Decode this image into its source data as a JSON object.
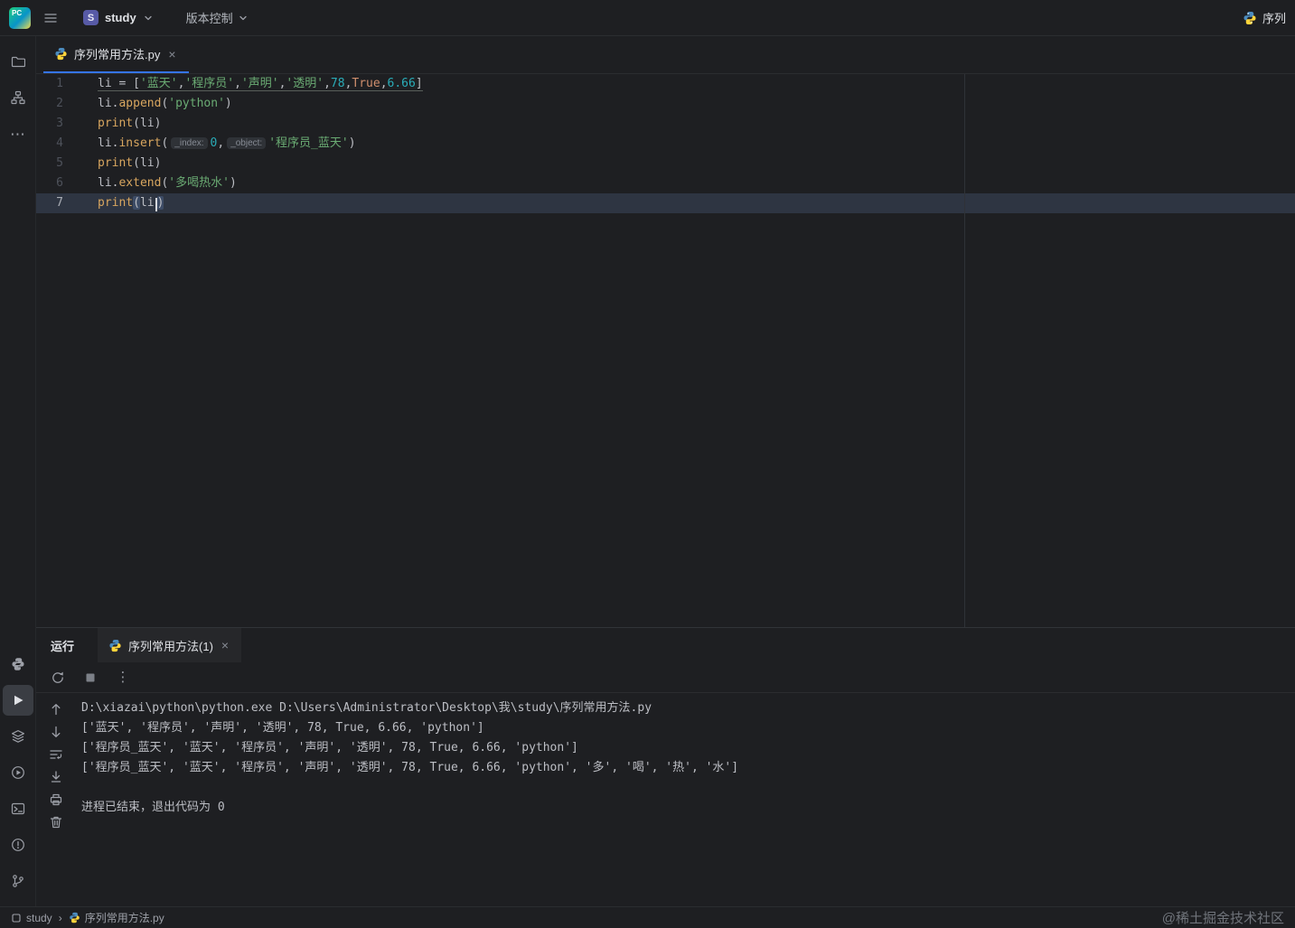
{
  "titlebar": {
    "logo": "PC",
    "project_badge": "S",
    "project": "study",
    "vcs": "版本控制",
    "run_config": "序列"
  },
  "editor": {
    "tab_label": "序列常用方法.py",
    "close": "×",
    "lines": [
      {
        "n": 1,
        "active": false,
        "tokens": [
          {
            "t": "li",
            "c": "v u"
          },
          {
            "t": " = ",
            "c": "v u"
          },
          {
            "t": "[",
            "c": "v u"
          },
          {
            "t": "'蓝天'",
            "c": "s u"
          },
          {
            "t": ",",
            "c": "v u"
          },
          {
            "t": "'程序员'",
            "c": "s u"
          },
          {
            "t": ",",
            "c": "v u"
          },
          {
            "t": "'声明'",
            "c": "s u"
          },
          {
            "t": ",",
            "c": "v u"
          },
          {
            "t": "'透明'",
            "c": "s u"
          },
          {
            "t": ",",
            "c": "v u"
          },
          {
            "t": "78",
            "c": "n u"
          },
          {
            "t": ",",
            "c": "v u"
          },
          {
            "t": "True",
            "c": "k u"
          },
          {
            "t": ",",
            "c": "v u"
          },
          {
            "t": "6.66",
            "c": "n u"
          },
          {
            "t": "]",
            "c": "v u"
          }
        ]
      },
      {
        "n": 2,
        "active": false,
        "tokens": [
          {
            "t": "li.",
            "c": "v"
          },
          {
            "t": "append",
            "c": "m"
          },
          {
            "t": "(",
            "c": "v"
          },
          {
            "t": "'python'",
            "c": "s"
          },
          {
            "t": ")",
            "c": "v"
          }
        ]
      },
      {
        "n": 3,
        "active": false,
        "tokens": [
          {
            "t": "print",
            "c": "m"
          },
          {
            "t": "(",
            "c": "v"
          },
          {
            "t": "li",
            "c": "v"
          },
          {
            "t": ")",
            "c": "v"
          }
        ]
      },
      {
        "n": 4,
        "active": false,
        "tokens": [
          {
            "t": "li.",
            "c": "v"
          },
          {
            "t": "insert",
            "c": "m"
          },
          {
            "t": "(",
            "c": "v"
          },
          {
            "t": "_index:",
            "c": "h"
          },
          {
            "t": "0",
            "c": "n"
          },
          {
            "t": ",",
            "c": "v"
          },
          {
            "t": "_object:",
            "c": "h"
          },
          {
            "t": "'程序员_蓝天'",
            "c": "s"
          },
          {
            "t": ")",
            "c": "v"
          }
        ]
      },
      {
        "n": 5,
        "active": false,
        "tokens": [
          {
            "t": "print",
            "c": "m"
          },
          {
            "t": "(",
            "c": "v"
          },
          {
            "t": "li",
            "c": "v"
          },
          {
            "t": ")",
            "c": "v"
          }
        ]
      },
      {
        "n": 6,
        "active": false,
        "tokens": [
          {
            "t": "li.",
            "c": "v"
          },
          {
            "t": "extend",
            "c": "m"
          },
          {
            "t": "(",
            "c": "v"
          },
          {
            "t": "'多喝热水'",
            "c": "s"
          },
          {
            "t": ")",
            "c": "v"
          }
        ]
      },
      {
        "n": 7,
        "active": true,
        "tokens": [
          {
            "t": "print",
            "c": "m"
          },
          {
            "t": "(",
            "c": "v sel"
          },
          {
            "t": "li",
            "c": "v",
            "caretAfter": true
          },
          {
            "t": ")",
            "c": "v sel"
          }
        ]
      }
    ]
  },
  "run_panel": {
    "title": "运行",
    "tab_label": "序列常用方法(1)",
    "close": "×",
    "console": [
      "D:\\xiazai\\python\\python.exe D:\\Users\\Administrator\\Desktop\\我\\study\\序列常用方法.py",
      "['蓝天', '程序员', '声明', '透明', 78, True, 6.66, 'python']",
      "['程序员_蓝天', '蓝天', '程序员', '声明', '透明', 78, True, 6.66, 'python']",
      "['程序员_蓝天', '蓝天', '程序员', '声明', '透明', 78, True, 6.66, 'python', '多', '喝', '热', '水']",
      "",
      "进程已结束，退出代码为 0"
    ]
  },
  "statusbar": {
    "project": "study",
    "separator": "›",
    "file": "序列常用方法.py",
    "watermark": "@稀土掘金技术社区"
  },
  "colors": {
    "bg": "#1e1f22",
    "border": "#2b2d30",
    "accent": "#3574f0",
    "string": "#6aab73",
    "number": "#2aacb8",
    "keyword": "#cf8e6d",
    "method": "#d8a65f",
    "caret_row": "#2e3542"
  }
}
